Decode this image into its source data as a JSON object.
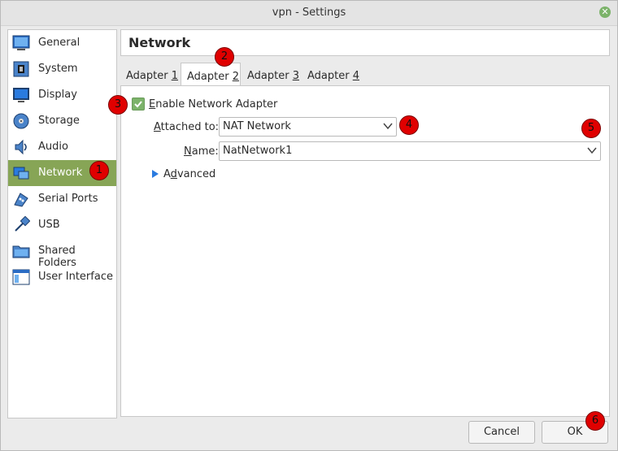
{
  "window": {
    "title": "vpn - Settings",
    "close_icon": "close-icon"
  },
  "sidebar": {
    "active_color": "#87a556",
    "items": [
      {
        "label": "General",
        "icon": "general-icon"
      },
      {
        "label": "System",
        "icon": "system-icon"
      },
      {
        "label": "Display",
        "icon": "display-icon"
      },
      {
        "label": "Storage",
        "icon": "storage-icon"
      },
      {
        "label": "Audio",
        "icon": "audio-icon"
      },
      {
        "label": "Network",
        "icon": "network-icon",
        "active": true
      },
      {
        "label": "Serial Ports",
        "icon": "serial-ports-icon"
      },
      {
        "label": "USB",
        "icon": "usb-icon"
      },
      {
        "label": "Shared Folders",
        "icon": "shared-folders-icon"
      },
      {
        "label": "User Interface",
        "icon": "user-interface-icon"
      }
    ]
  },
  "section": {
    "title": "Network"
  },
  "tabs": [
    {
      "label": "Adapter ",
      "key": "1"
    },
    {
      "label": "Adapter ",
      "key": "2",
      "active": true
    },
    {
      "label": "Adapter ",
      "key": "3"
    },
    {
      "label": "Adapter ",
      "key": "4"
    }
  ],
  "adapter": {
    "enable_label_key": "E",
    "enable_label_rest": "nable Network Adapter",
    "enabled": true,
    "attached_label_key": "A",
    "attached_label_rest": "ttached to:",
    "attached_value": "NAT Network",
    "name_label_key": "N",
    "name_label_rest": "ame:",
    "name_value": "NatNetwork1",
    "advanced_label_key": "d",
    "advanced_label_pre": "A",
    "advanced_label_post": "vanced"
  },
  "buttons": {
    "cancel": "Cancel",
    "ok": "OK"
  },
  "markers": [
    "1",
    "2",
    "3",
    "4",
    "5",
    "6"
  ],
  "colors": {
    "accent": "#7cb36a",
    "marker": "#e00000"
  }
}
